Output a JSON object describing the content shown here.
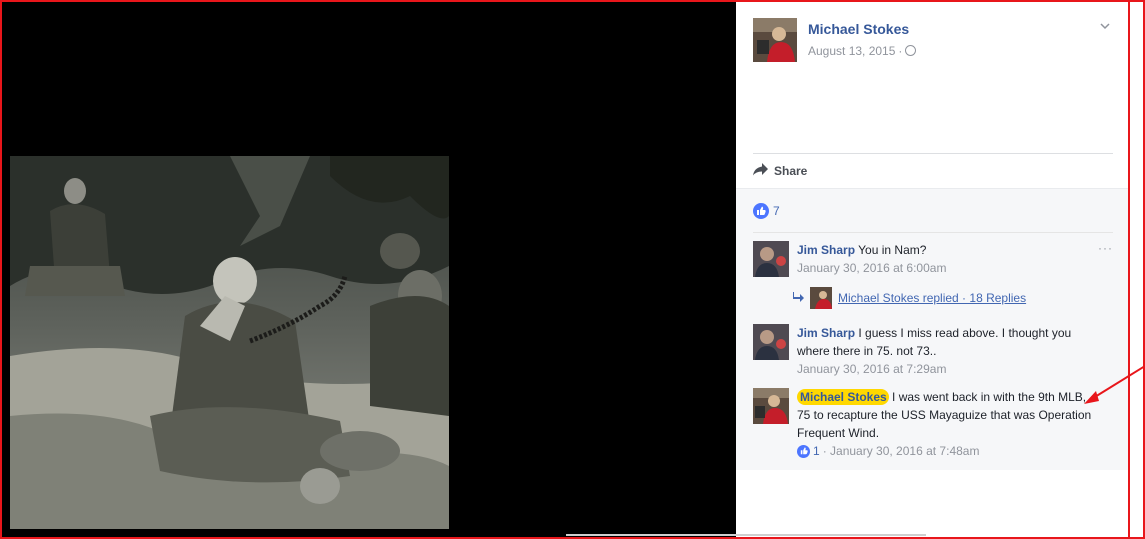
{
  "post": {
    "author": "Michael Stokes",
    "date": "August 13, 2015",
    "separator": "·",
    "privacy_icon": "globe-icon"
  },
  "actions": {
    "share_label": "Share",
    "share_icon": "share-arrow-icon"
  },
  "likes": {
    "count": "7",
    "icon": "thumbs-up-icon"
  },
  "comments": [
    {
      "name": "Jim Sharp",
      "text": "You in Nam?",
      "time": "January 30, 2016 at 6:00am",
      "menu": "···"
    },
    {
      "name": "Jim Sharp",
      "text": "I guess I miss read above. I thought you where there in 75. not 73..",
      "time": "January 30, 2016 at 7:29am"
    },
    {
      "name": "Michael Stokes",
      "text": "I was went back in with the 9th MLB, 75 to recapture the USS Mayaguize that was Operation Frequent Wind.",
      "likes": "1",
      "time": "· January 30, 2016 at 7:48am"
    }
  ],
  "reply": {
    "text": "Michael Stokes replied · 18 Replies",
    "icon": "reply-arrow-icon"
  },
  "colors": {
    "link": "#365899",
    "accent": "#4267b2",
    "highlight": "#ffd800",
    "annotation": "#e8161b",
    "meta_gray": "#90949c"
  }
}
